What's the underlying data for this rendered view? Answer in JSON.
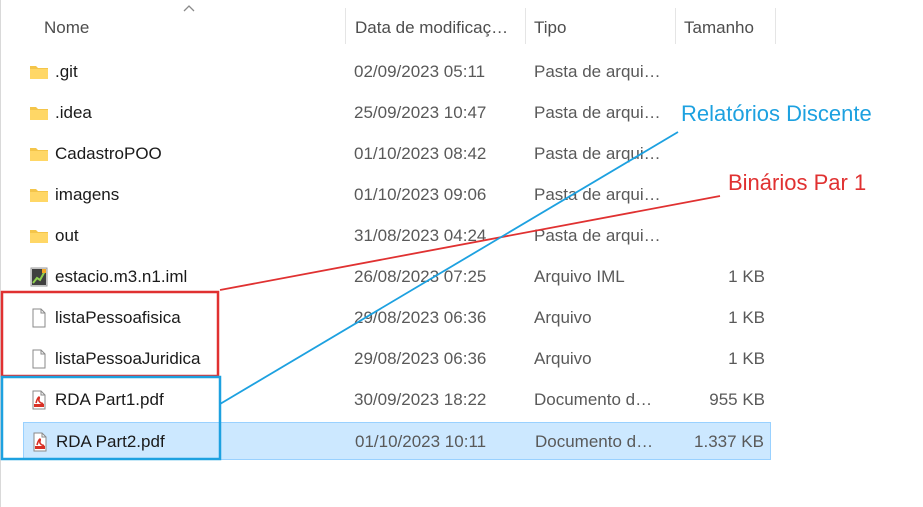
{
  "columns": {
    "name": "Nome",
    "date": "Data de modificaç…",
    "type": "Tipo",
    "size": "Tamanho"
  },
  "files": [
    {
      "icon": "folder-icon",
      "name": ".git",
      "date": "02/09/2023 05:11",
      "type": "Pasta de arqui…",
      "size": ""
    },
    {
      "icon": "folder-icon",
      "name": ".idea",
      "date": "25/09/2023 10:47",
      "type": "Pasta de arqui…",
      "size": ""
    },
    {
      "icon": "folder-icon",
      "name": "CadastroPOO",
      "date": "01/10/2023 08:42",
      "type": "Pasta de arqui…",
      "size": ""
    },
    {
      "icon": "folder-icon",
      "name": "imagens",
      "date": "01/10/2023 09:06",
      "type": "Pasta de arqui…",
      "size": ""
    },
    {
      "icon": "folder-icon",
      "name": "out",
      "date": "31/08/2023 04:24",
      "type": "Pasta de arqui…",
      "size": ""
    },
    {
      "icon": "iml-file-icon",
      "name": "estacio.m3.n1.iml",
      "date": "26/08/2023 07:25",
      "type": "Arquivo IML",
      "size": "1 KB"
    },
    {
      "icon": "blank-file-icon",
      "name": "listaPessoafisica",
      "date": "29/08/2023 06:36",
      "type": "Arquivo",
      "size": "1 KB"
    },
    {
      "icon": "blank-file-icon",
      "name": "listaPessoaJuridica",
      "date": "29/08/2023 06:36",
      "type": "Arquivo",
      "size": "1 KB"
    },
    {
      "icon": "pdf-file-icon",
      "name": "RDA Part1.pdf",
      "date": "30/09/2023 18:22",
      "type": "Documento d…",
      "size": "955 KB"
    },
    {
      "icon": "pdf-file-icon",
      "name": "RDA Part2.pdf",
      "date": "01/10/2023 10:11",
      "type": "Documento d…",
      "size": "1.337 KB",
      "selected": true
    }
  ],
  "annotations": {
    "blue_label": "Relatórios Discente",
    "red_label": "Binários Par 1",
    "blue_color": "#1da1e0",
    "red_color": "#e03131"
  },
  "colors": {
    "selection_bg": "#cce8ff",
    "selection_border": "#99d1ff",
    "folder": "#f4c54a"
  }
}
